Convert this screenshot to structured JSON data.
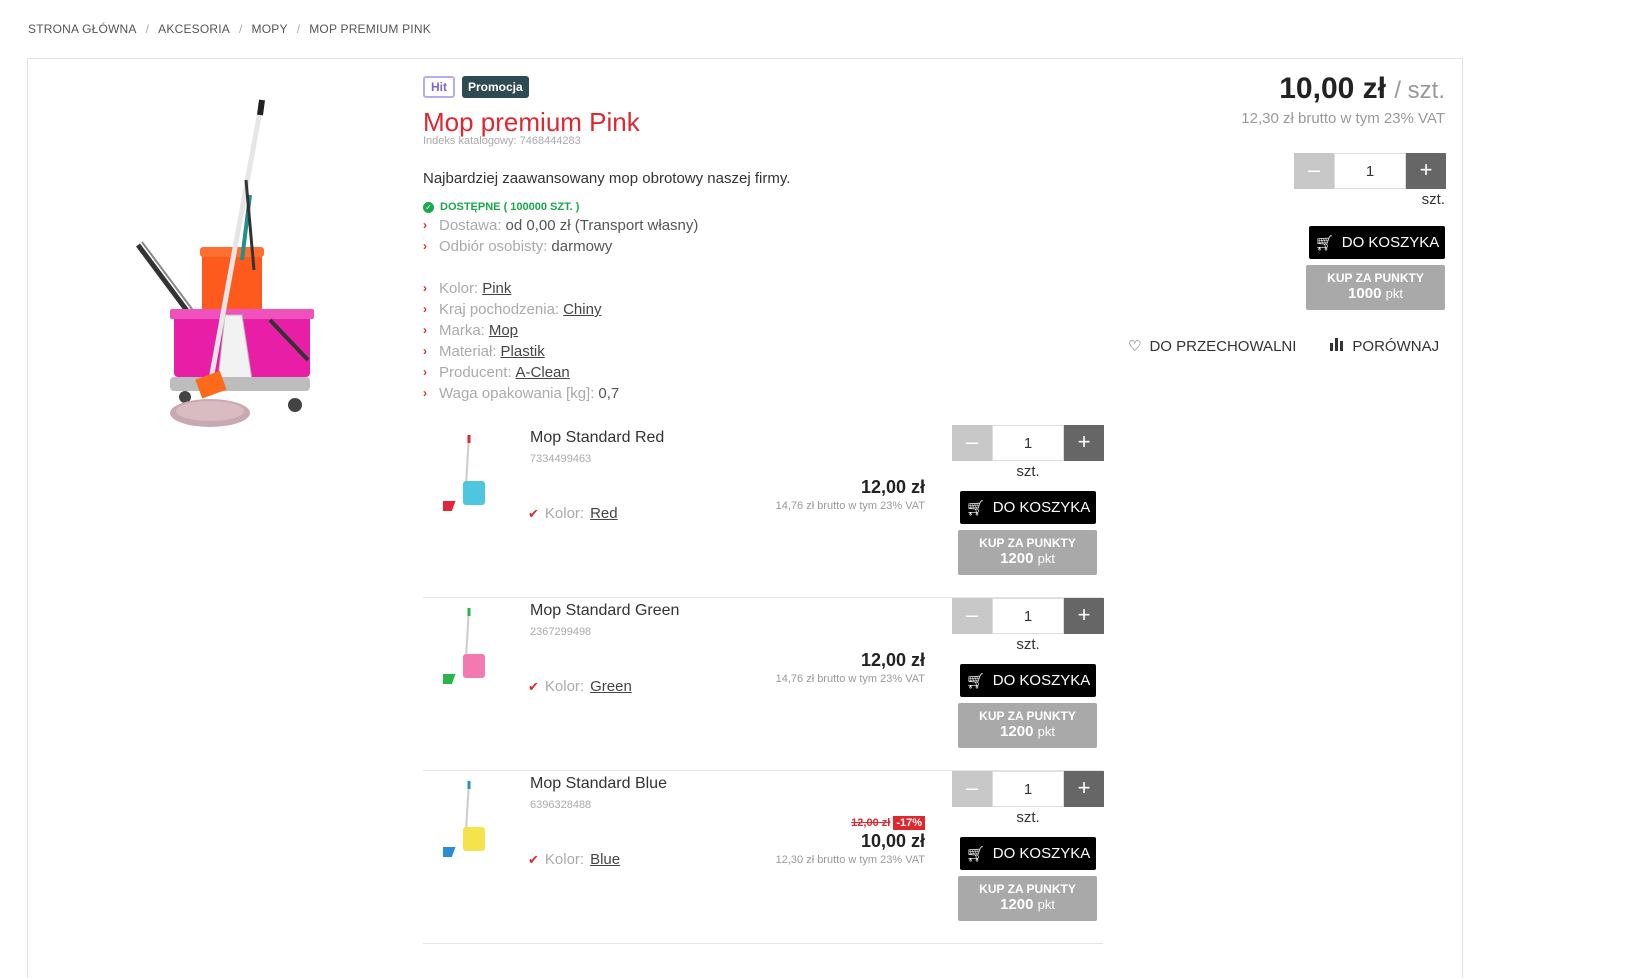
{
  "breadcrumb": [
    "STRONA GŁÓWNA",
    "AKCESORIA",
    "MOPY",
    "MOP PREMIUM PINK"
  ],
  "product": {
    "badges": {
      "hit": "Hit",
      "promo": "Promocja"
    },
    "title": "Mop premium Pink",
    "catalog_index": "Indeks katalogowy: 7468444283",
    "description": "Najbardziej zaawansowany mop obrotowy naszej firmy.",
    "availability": "DOSTĘPNE ( 100000 SZT. )",
    "delivery": {
      "label": "Dostawa:",
      "value": "od 0,00 zł (Transport własny)"
    },
    "pickup": {
      "label": "Odbiór osobisty:",
      "value": "darmowy"
    },
    "attributes": [
      {
        "label": "Kolor:",
        "value": "Pink"
      },
      {
        "label": "Kraj pochodzenia:",
        "value": "Chiny"
      },
      {
        "label": "Marka:",
        "value": "Mop"
      },
      {
        "label": "Materiał:",
        "value": "Plastik"
      },
      {
        "label": "Producent:",
        "value": "A-Clean"
      }
    ],
    "weight": {
      "label": "Waga opakowania [kg]:",
      "value": "0,7"
    },
    "price": "10,00 zł",
    "price_unit": "/ szt.",
    "price_gross": "12,30 zł brutto w tym 23% VAT",
    "qty": "1",
    "unit": "szt.",
    "cart_label": "DO KOSZYKA",
    "points_label": "KUP ZA PUNKTY",
    "points_value": "1000",
    "points_unit": "pkt",
    "wishlist_label": "DO PRZECHOWALNI",
    "compare_label": "PORÓWNAJ"
  },
  "variants": [
    {
      "name": "Mop Standard Red",
      "index": "7334499463",
      "color_label": "Kolor:",
      "color": "Red",
      "price": "12,00 zł",
      "old_price": "",
      "discount": "",
      "gross": "14,76 zł brutto w tym 23% VAT",
      "qty": "1",
      "unit": "szt.",
      "cart": "DO KOSZYKA",
      "points_label": "KUP ZA PUNKTY",
      "points": "1200",
      "points_unit": "pkt",
      "bucket_color": "#4fc6e0",
      "pad_color": "#e0263a"
    },
    {
      "name": "Mop Standard Green",
      "index": "2367299498",
      "color_label": "Kolor:",
      "color": "Green",
      "price": "12,00 zł",
      "old_price": "",
      "discount": "",
      "gross": "14,76 zł brutto w tym 23% VAT",
      "qty": "1",
      "unit": "szt.",
      "cart": "DO KOSZYKA",
      "points_label": "KUP ZA PUNKTY",
      "points": "1200",
      "points_unit": "pkt",
      "bucket_color": "#f27ab0",
      "pad_color": "#2ab54a"
    },
    {
      "name": "Mop Standard Blue",
      "index": "6396328488",
      "color_label": "Kolor:",
      "color": "Blue",
      "price": "10,00 zł",
      "old_price": "12,00 zł",
      "discount": "-17%",
      "gross": "12,30 zł brutto w tym 23% VAT",
      "qty": "1",
      "unit": "szt.",
      "cart": "DO KOSZYKA",
      "points_label": "KUP ZA PUNKTY",
      "points": "1200",
      "points_unit": "pkt",
      "bucket_color": "#f6e24a",
      "pad_color": "#2a8ed6"
    }
  ]
}
